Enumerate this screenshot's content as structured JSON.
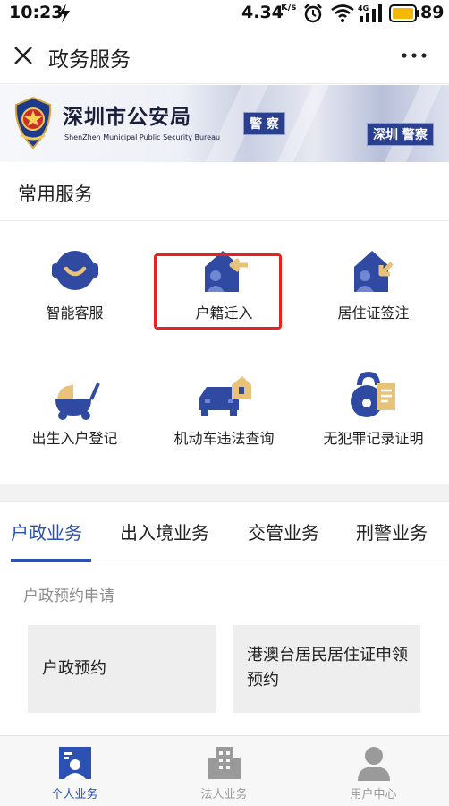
{
  "status_bar": {
    "time": "10:23",
    "net_speed": "4.34",
    "net_speed_unit": "K/s",
    "battery_level": "89",
    "icons": [
      "charging-bolt-icon",
      "alarm-icon",
      "wifi-icon",
      "signal-4g-icon",
      "battery-icon"
    ]
  },
  "nav": {
    "title": "政务服务",
    "close_icon": "close-icon",
    "more_icon": "more-dots-icon"
  },
  "banner": {
    "title": "深圳市公安局",
    "subtitle": "ShenZhen Municipal Public Security Bureau",
    "sign_left": "警 察",
    "sign_right": "深圳 警察"
  },
  "common_services": {
    "title": "常用服务",
    "items": [
      {
        "label": "智能客服",
        "icon": "customer-service-icon"
      },
      {
        "label": "户籍迁入",
        "icon": "household-move-in-icon"
      },
      {
        "label": "居住证签注",
        "icon": "residence-permit-icon"
      },
      {
        "label": "出生入户登记",
        "icon": "birth-registration-icon"
      },
      {
        "label": "机动车违法查询",
        "icon": "vehicle-violation-icon"
      },
      {
        "label": "无犯罪记录证明",
        "icon": "no-criminal-record-icon"
      }
    ]
  },
  "tabs": [
    {
      "label": "户政业务",
      "active": true
    },
    {
      "label": "出入境业务",
      "active": false
    },
    {
      "label": "交管业务",
      "active": false
    },
    {
      "label": "刑警业务",
      "active": false
    }
  ],
  "section": {
    "subheading": "户政预约申请",
    "cards": [
      {
        "label": "户政预约"
      },
      {
        "label": "港澳台居民居住证申领预约"
      }
    ]
  },
  "bottom_nav": [
    {
      "label": "个人业务",
      "icon": "personal-business-icon",
      "active": true
    },
    {
      "label": "法人业务",
      "icon": "building-icon",
      "active": false
    },
    {
      "label": "用户中心",
      "icon": "user-icon",
      "active": false
    }
  ],
  "colors": {
    "brand_blue": "#2b52b2",
    "icon_navy": "#2f4aa0",
    "icon_gold": "#e9c27a",
    "highlight_red": "#e8231f"
  }
}
